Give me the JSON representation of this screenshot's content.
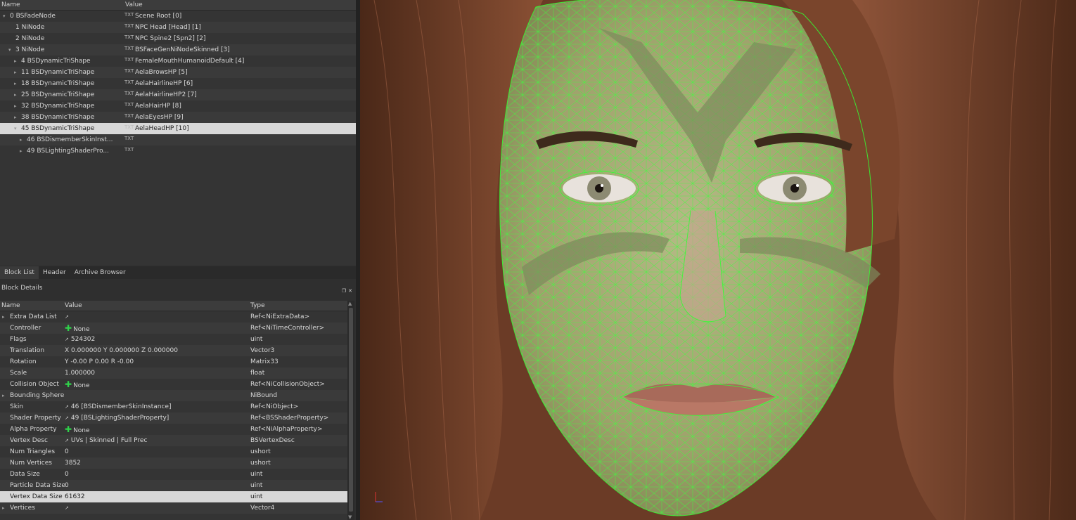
{
  "tree": {
    "col_name": "Name",
    "col_value": "Value",
    "rows": [
      {
        "name": "0 BSFadeNode",
        "value": "Scene Root [0]",
        "indent": 0,
        "arrow": "▾"
      },
      {
        "name": "1 NiNode",
        "value": "NPC Head [Head] [1]",
        "indent": 1,
        "arrow": ""
      },
      {
        "name": "2 NiNode",
        "value": "NPC Spine2 [Spn2] [2]",
        "indent": 1,
        "arrow": ""
      },
      {
        "name": "3 NiNode",
        "value": "BSFaceGenNiNodeSkinned [3]",
        "indent": 1,
        "arrow": "▾"
      },
      {
        "name": "4 BSDynamicTriShape",
        "value": "FemaleMouthHumanoidDefault [4]",
        "indent": 2,
        "arrow": "▸"
      },
      {
        "name": "11 BSDynamicTriShape",
        "value": "AelaBrowsHP [5]",
        "indent": 2,
        "arrow": "▸"
      },
      {
        "name": "18 BSDynamicTriShape",
        "value": "AelaHairlineHP [6]",
        "indent": 2,
        "arrow": "▸"
      },
      {
        "name": "25 BSDynamicTriShape",
        "value": "AelaHairlineHP2 [7]",
        "indent": 2,
        "arrow": "▸"
      },
      {
        "name": "32 BSDynamicTriShape",
        "value": "AelaHairHP [8]",
        "indent": 2,
        "arrow": "▸"
      },
      {
        "name": "38 BSDynamicTriShape",
        "value": "AelaEyesHP [9]",
        "indent": 2,
        "arrow": "▸"
      },
      {
        "name": "45 BSDynamicTriShape",
        "value": "AelaHeadHP [10]",
        "indent": 2,
        "arrow": "▾"
      },
      {
        "name": "46 BSDismemberSkinInst...",
        "value": "",
        "indent": 3,
        "arrow": "▸"
      },
      {
        "name": "49 BSLightingShaderPro...",
        "value": "",
        "indent": 3,
        "arrow": "▸"
      }
    ]
  },
  "tabs": [
    "Block List",
    "Header",
    "Archive Browser"
  ],
  "details": {
    "title": "Block Details",
    "col_name": "Name",
    "col_value": "Value",
    "col_type": "Type",
    "rows": [
      {
        "name": "Extra Data List",
        "value": "",
        "type": "Ref<NiExtraData>",
        "prefix": "link",
        "exp": "▸"
      },
      {
        "name": "Controller",
        "value": "None",
        "type": "Ref<NiTimeController>",
        "prefix": "plus",
        "exp": ""
      },
      {
        "name": "Flags",
        "value": "524302",
        "type": "uint",
        "prefix": "link",
        "exp": ""
      },
      {
        "name": "Translation",
        "value": "X 0.000000 Y 0.000000 Z 0.000000",
        "type": "Vector3",
        "prefix": "",
        "exp": ""
      },
      {
        "name": "Rotation",
        "value": "Y -0.00 P 0.00 R -0.00",
        "type": "Matrix33",
        "prefix": "",
        "exp": ""
      },
      {
        "name": "Scale",
        "value": "1.000000",
        "type": "float",
        "prefix": "",
        "exp": ""
      },
      {
        "name": "Collision Object",
        "value": "None",
        "type": "Ref<NiCollisionObject>",
        "prefix": "plus",
        "exp": ""
      },
      {
        "name": "Bounding Sphere",
        "value": "",
        "type": "NiBound",
        "prefix": "",
        "exp": "▸"
      },
      {
        "name": "Skin",
        "value": "46 [BSDismemberSkinInstance]",
        "type": "Ref<NiObject>",
        "prefix": "link",
        "exp": ""
      },
      {
        "name": "Shader Property",
        "value": "49 [BSLightingShaderProperty]",
        "type": "Ref<BSShaderProperty>",
        "prefix": "link",
        "exp": ""
      },
      {
        "name": "Alpha Property",
        "value": "None",
        "type": "Ref<NiAlphaProperty>",
        "prefix": "plus",
        "exp": ""
      },
      {
        "name": "Vertex Desc",
        "value": "UVs | Skinned | Full Prec",
        "type": "BSVertexDesc",
        "prefix": "link",
        "exp": ""
      },
      {
        "name": "Num Triangles",
        "value": "0",
        "type": "ushort",
        "prefix": "",
        "exp": ""
      },
      {
        "name": "Num Vertices",
        "value": "3852",
        "type": "ushort",
        "prefix": "",
        "exp": ""
      },
      {
        "name": "Data Size",
        "value": "0",
        "type": "uint",
        "prefix": "",
        "exp": ""
      },
      {
        "name": "Particle Data Size",
        "value": "0",
        "type": "uint",
        "prefix": "",
        "exp": ""
      },
      {
        "name": "Vertex Data Size",
        "value": "61632",
        "type": "uint",
        "prefix": "",
        "exp": ""
      },
      {
        "name": "Vertices",
        "value": "",
        "type": "Vector4",
        "prefix": "link",
        "exp": "▸"
      }
    ]
  },
  "colors": {
    "wire": "#33ff33",
    "hair": "#7a452c",
    "skin": "#c99b86"
  }
}
